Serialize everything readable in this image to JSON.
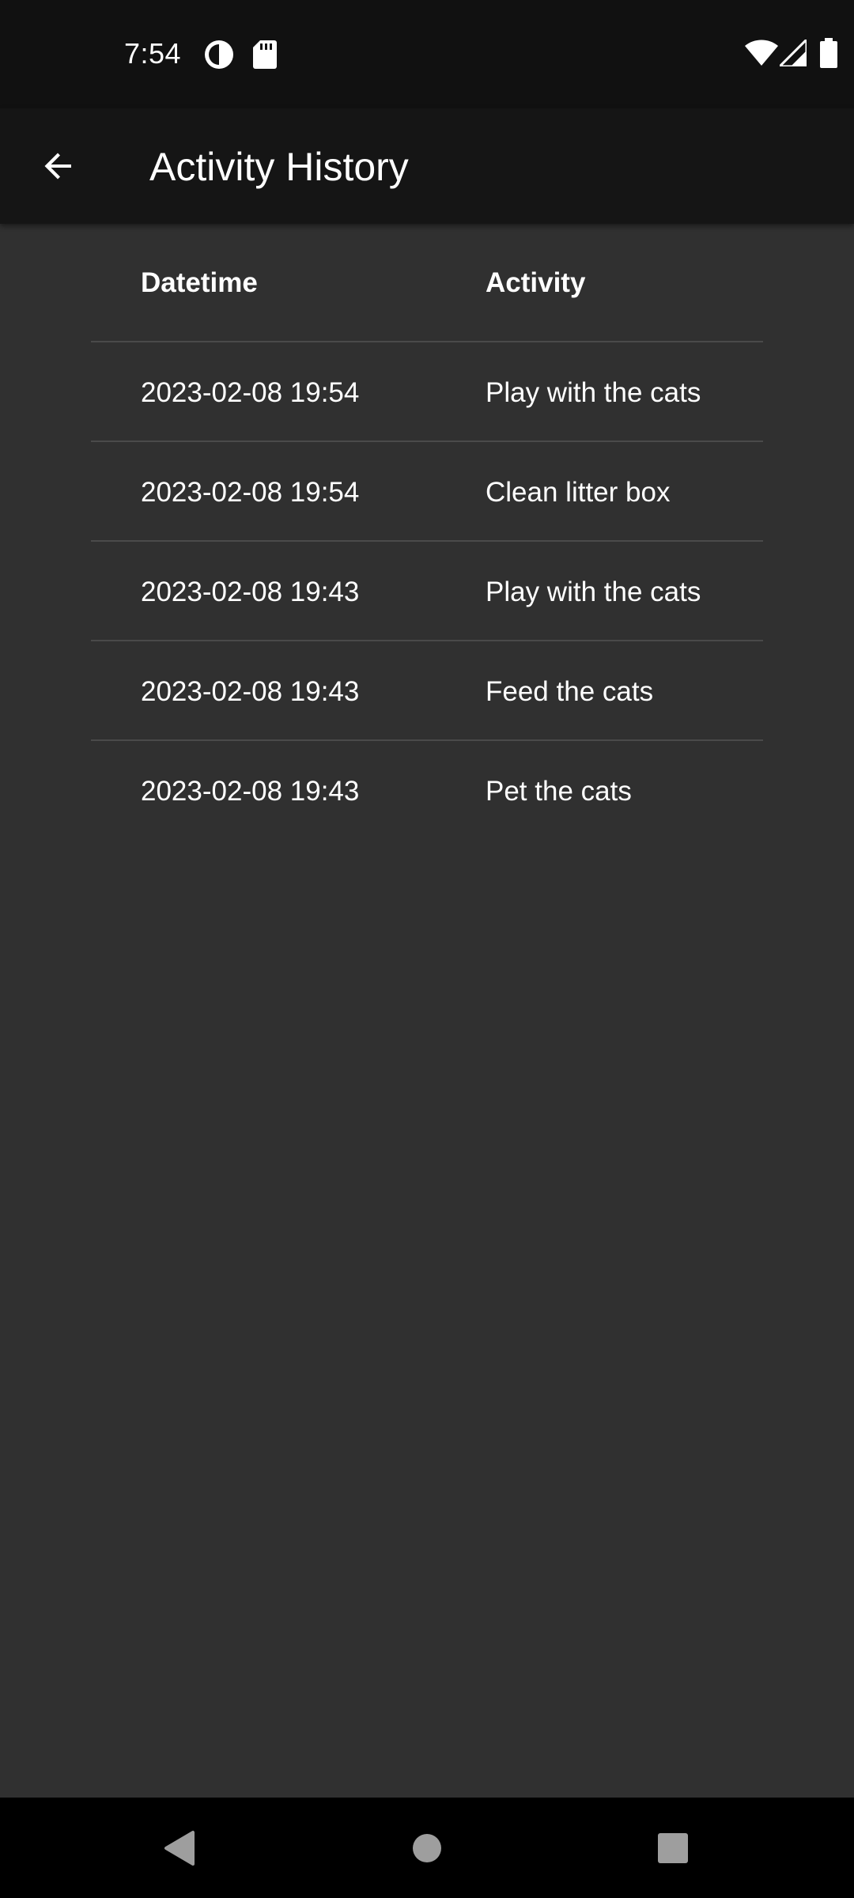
{
  "status_bar": {
    "time": "7:54",
    "left_icons": [
      "data-saver-icon",
      "sd-card-icon"
    ],
    "right_icons": [
      "wifi-icon",
      "cellular-signal-icon",
      "battery-icon"
    ]
  },
  "app_bar": {
    "back_icon": "arrow-back-icon",
    "title": "Activity History"
  },
  "table": {
    "headers": {
      "datetime": "Datetime",
      "activity": "Activity"
    },
    "rows": [
      {
        "datetime": "2023-02-08 19:54",
        "activity": "Play with the cats"
      },
      {
        "datetime": "2023-02-08 19:54",
        "activity": "Clean litter box"
      },
      {
        "datetime": "2023-02-08 19:43",
        "activity": "Play with the cats"
      },
      {
        "datetime": "2023-02-08 19:43",
        "activity": "Feed the cats"
      },
      {
        "datetime": "2023-02-08 19:43",
        "activity": "Pet the cats"
      }
    ]
  },
  "nav_bar": {
    "buttons": [
      "back-triangle-icon",
      "home-circle-icon",
      "recents-square-icon"
    ]
  },
  "colors": {
    "status_bar_bg": "#111111",
    "app_bar_bg": "#151515",
    "content_bg": "#303030",
    "divider": "#4a4a4a",
    "nav_bar_bg": "#000000",
    "nav_icon": "#9e9e9e",
    "text": "#ffffff"
  }
}
